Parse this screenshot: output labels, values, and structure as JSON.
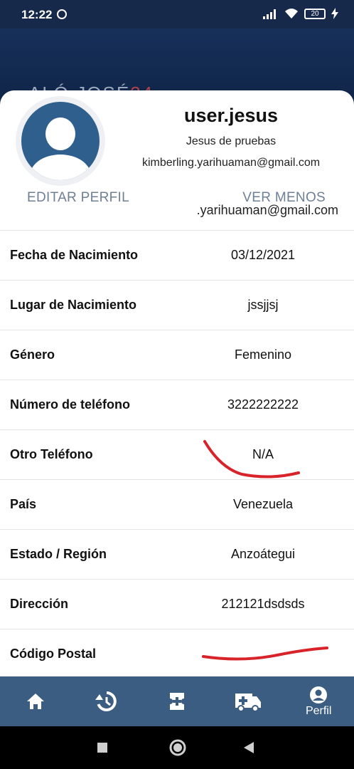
{
  "status_bar": {
    "time": "12:22",
    "battery": "20"
  },
  "banner": {
    "logo_main": "ALÓ JOSÉ",
    "logo_accent": "24"
  },
  "profile": {
    "username": "user.jesus",
    "full_name": "Jesus de pruebas",
    "email": "kimberling.yarihuaman@gmail.com",
    "edit_label": "EDITAR PERFIL",
    "toggle_label": "VER MENOS",
    "peek_email": ".yarihuaman@gmail.com"
  },
  "fields": [
    {
      "label": "Fecha de Nacimiento",
      "value": "03/12/2021"
    },
    {
      "label": "Lugar de Nacimiento",
      "value": "jssjjsj"
    },
    {
      "label": "Género",
      "value": "Femenino"
    },
    {
      "label": "Número de teléfono",
      "value": "3222222222"
    },
    {
      "label": "Otro Teléfono",
      "value": "N/A"
    },
    {
      "label": "País",
      "value": "Venezuela"
    },
    {
      "label": "Estado / Región",
      "value": "Anzoátegui"
    },
    {
      "label": "Dirección",
      "value": "212121dsdsds"
    },
    {
      "label": "Código Postal",
      "value": ""
    }
  ],
  "bottom_nav": {
    "items": [
      {
        "icon": "home-icon",
        "label": ""
      },
      {
        "icon": "history-icon",
        "label": ""
      },
      {
        "icon": "medical-add-icon",
        "label": ""
      },
      {
        "icon": "ambulance-icon",
        "label": ""
      },
      {
        "icon": "account-circle-icon",
        "label": "Perfil"
      }
    ]
  },
  "colors": {
    "nav_bg": "#3b5d82",
    "link": "#6e8096",
    "avatar_bg": "#2e5f8d",
    "annotation": "#d8232a"
  }
}
